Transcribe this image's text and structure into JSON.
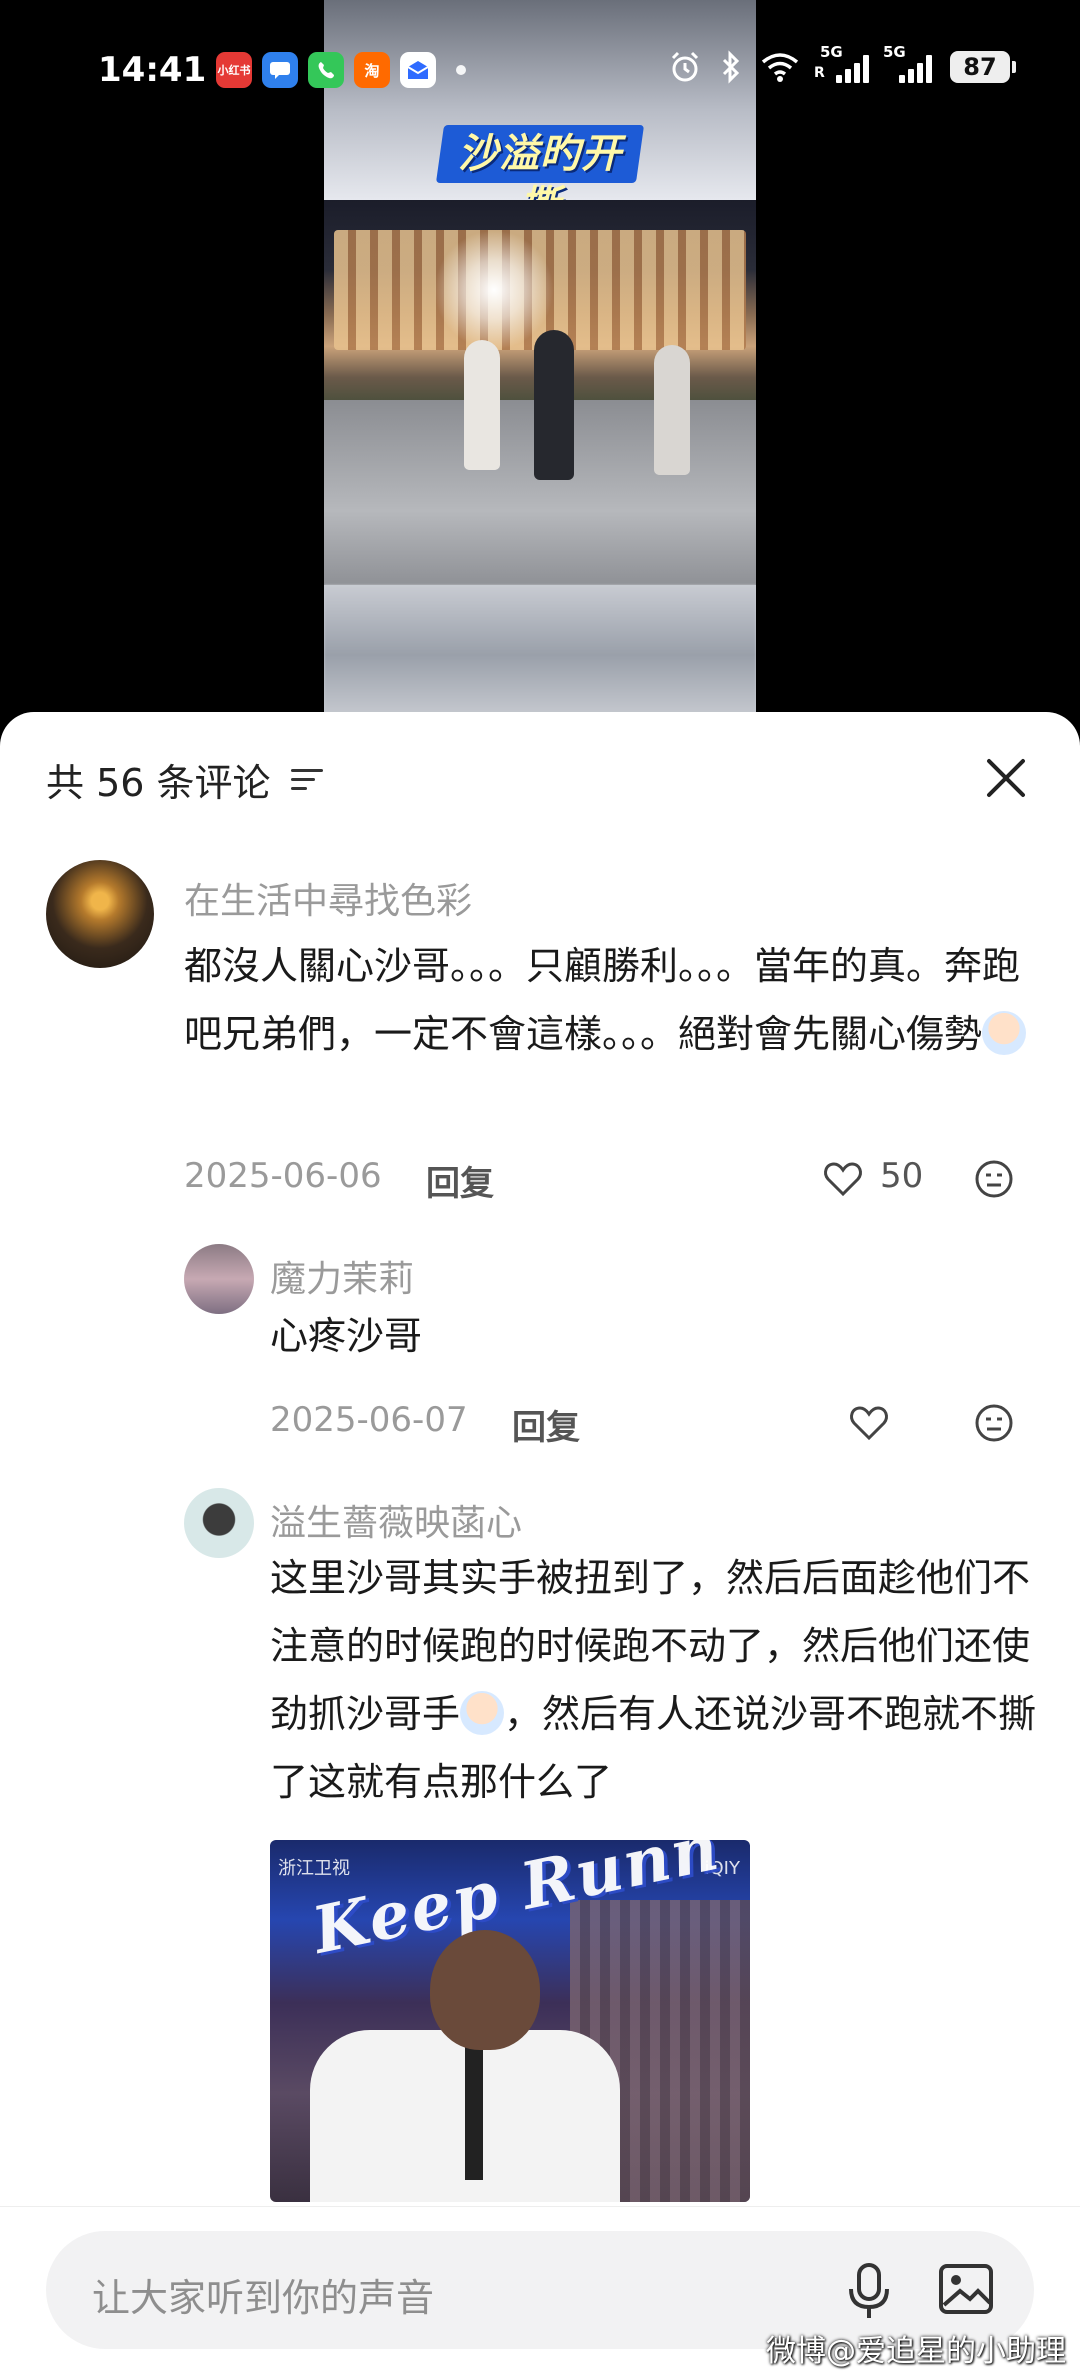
{
  "status_bar": {
    "time": "14:41",
    "apps": [
      "小红书",
      "",
      "",
      "淘",
      ""
    ],
    "signal_1": "5G",
    "signal_1_sub": "R",
    "signal_2": "5G",
    "battery": "87"
  },
  "video": {
    "title": "沙溢旳开撕"
  },
  "panel": {
    "count_label": "共 56 条评论"
  },
  "comments": [
    {
      "username": "在生活中尋找色彩",
      "text": "都沒人關心沙哥。。。只顧勝利。。。當年的真。奔跑吧兄弟們，一定不會這樣。。。絕對會先關心傷勢",
      "date": "2025-06-06",
      "reply": "回复",
      "likes": "50"
    },
    {
      "username": "魔力茉莉",
      "text": "心疼沙哥",
      "date": "2025-06-07",
      "reply": "回复"
    },
    {
      "username": "溢生薔薇映菡心",
      "text_part1": "这里沙哥其实手被扭到了，然后后面趁他们不注意的时候跑的时候跑不动了，然后他们还使劲抓沙哥手",
      "text_part2": "，然后有人还说沙哥不跑就不撕了这就有点那什么了",
      "image_logo": "Keep Runn",
      "image_corner_left": "浙江卫视",
      "image_corner_right": "iQIY"
    }
  ],
  "input": {
    "placeholder": "让大家听到你的声音"
  },
  "watermark": "微博@爱追星的小助理",
  "colors": {
    "accent_blue": "#1d5bd6",
    "text_primary": "#1a1a1a",
    "text_secondary": "#9a9a9a"
  }
}
